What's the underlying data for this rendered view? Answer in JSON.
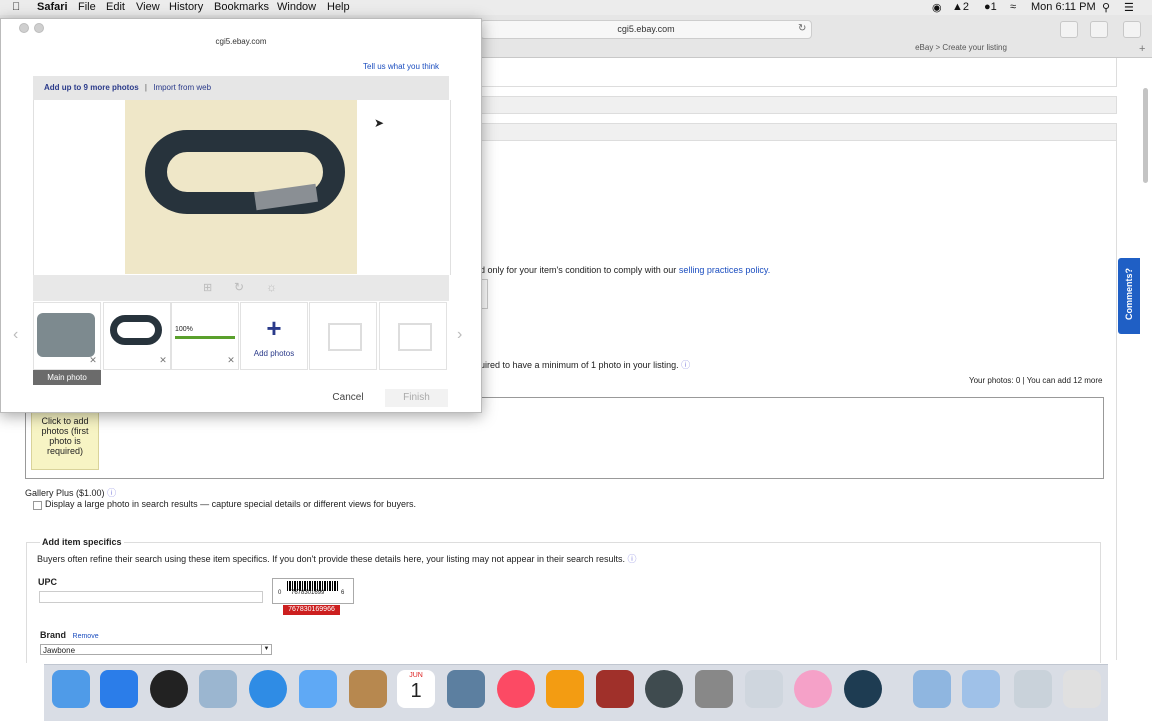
{
  "menubar": {
    "app": "Safari",
    "items": [
      "File",
      "Edit",
      "View",
      "History",
      "Bookmarks",
      "Window",
      "Help"
    ],
    "status_right": {
      "badge_a": "2",
      "badge_b": "1",
      "clock": "Mon 6:11 PM"
    }
  },
  "browser": {
    "url": "cgi5.ebay.com",
    "tab_title": "eBay > Create your listing",
    "popup_url": "cgi5.ebay.com"
  },
  "popup": {
    "feedback_link": "Tell us what you think",
    "add_more_label": "Add up to 9 more photos",
    "separator": "|",
    "import_label": "Import from web",
    "progress_label": "100%",
    "progress": 1.0,
    "add_photos_label": "Add photos",
    "main_photo_label": "Main photo",
    "cancel_label": "Cancel",
    "finish_label": "Finish"
  },
  "page": {
    "condition_text": "d only for your item's condition to comply with our",
    "policy_link": "selling practices policy.",
    "photo_min_text": "uired to have a minimum of 1 photo in your listing.",
    "your_photos": "Your photos: 0",
    "separator": "|",
    "you_can_add": "You can add 12 more",
    "click_to_add": "Click to add photos (first photo is required)",
    "gallery_plus": "Gallery Plus ($1.00)",
    "gallery_desc": "Display a large photo in search results — capture special details or different views for buyers.",
    "specifics_title": "Add item specifics",
    "specifics_desc": "Buyers often refine their search using these item specifics. If you don't provide these details here, your listing may not appear in their search results.",
    "upc_label": "UPC",
    "barcode_number": "767830169966",
    "barcode_digits": "7678301699",
    "barcode_first": "0",
    "barcode_last": "6",
    "brand_label": "Brand",
    "remove_label": "Remove",
    "brand_value": "Jawbone"
  },
  "comments_tab": "Comments?",
  "dock": {
    "items": [
      "finder-icon",
      "app-store-icon",
      "dashboard-icon",
      "preview-icon",
      "safari-icon",
      "messages-icon",
      "contacts-icon",
      "calendar-icon",
      "image-capture-icon",
      "itunes-icon",
      "ibooks-icon",
      "photo-booth-icon",
      "time-machine-icon",
      "system-preferences-icon",
      "mail-icon",
      "photos-icon",
      "quicktime-icon",
      "applications-folder-icon",
      "documents-folder-icon",
      "downloads-icon",
      "trash-icon"
    ],
    "calendar_month": "JUN",
    "calendar_day": "1"
  },
  "colors": {
    "accent": "#1a4dbf",
    "comments_bg": "#1f5fc5",
    "progress": "#5aa02c",
    "barcode_red": "#cc1f1f",
    "click_box_bg": "#f7f4c4"
  }
}
